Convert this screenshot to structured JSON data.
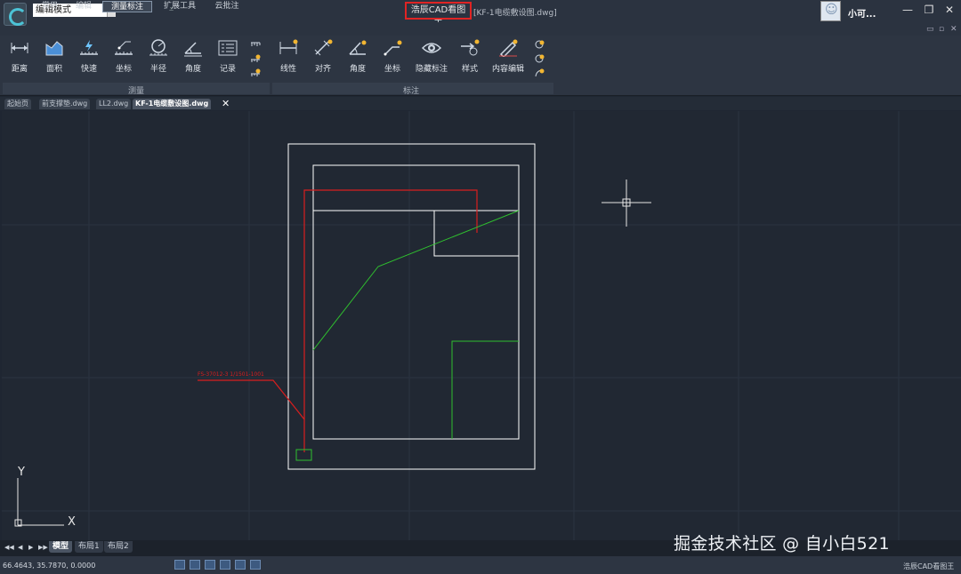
{
  "titlebar": {
    "mode_select_value": "编辑模式",
    "app_title": "浩辰CAD看图王",
    "file_title": "[KF-1电缆敷设图.dwg]",
    "user_name": "小可..."
  },
  "menu": {
    "tabs": [
      "常用",
      "编辑",
      "测量标注",
      "扩展工具",
      "云批注"
    ],
    "active_tab": "测量标注"
  },
  "ribbon": {
    "measure_tools": [
      "距离",
      "面积",
      "快速",
      "坐标",
      "半径",
      "角度",
      "记录"
    ],
    "annotate_tools": [
      "线性",
      "对齐",
      "角度",
      "坐标",
      "隐藏标注",
      "样式",
      "内容编辑"
    ],
    "group_measure": "测量",
    "group_annotate": "标注"
  },
  "doc_tabs": [
    "起始页",
    "前支撑垫.dwg",
    "LL2.dwg",
    "KF-1电缆敷设图.dwg"
  ],
  "active_doc": "KF-1电缆敷设图.dwg",
  "drawing": {
    "cable_label": "FS-37012-3 1/1501-1001",
    "axis_y": "Y",
    "axis_x": "X",
    "colors": {
      "border": "#ffffff",
      "red_cable": "#d91e1e",
      "green_line": "#2fbf2f",
      "background": "#212833"
    }
  },
  "layout_tabs": [
    "模型",
    "布局1",
    "布局2"
  ],
  "active_layout": "模型",
  "nav_buttons": [
    "◀◀",
    "◀",
    "▶",
    "▶▶"
  ],
  "status": {
    "coordinates": "66.4643, 35.7870, 0.0000",
    "app_name": "浩辰CAD看图王"
  },
  "watermark": "掘金技术社区 @ 自小白521"
}
